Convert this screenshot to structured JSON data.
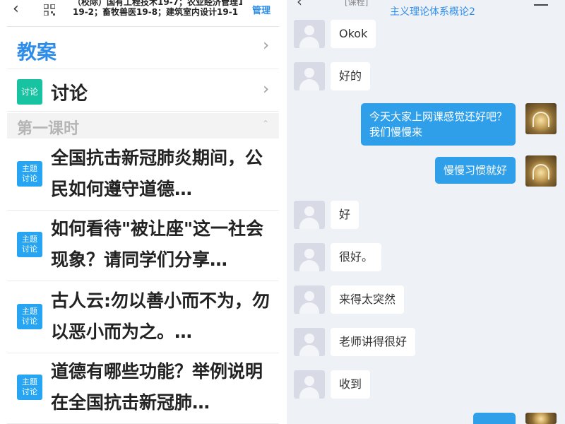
{
  "left_panel": {
    "header": {
      "back_icon": "back-arrow-icon",
      "qr_icon": "qr-code-icon",
      "class_line1": "（校际）国有工程技术19-7；农业经济管理19-",
      "class_line2": "19-2；畜牧兽医19-8；建筑室内设计19-1",
      "manage_label": "管理"
    },
    "jiaoan_label": "教案",
    "discussion": {
      "tag": "讨论",
      "label": "讨论"
    },
    "section_title": "第一课时",
    "topic_tag_line1": "主题",
    "topic_tag_line2": "讨论",
    "topics": [
      "全国抗击新冠肺炎期间，公民如何遵守道德…",
      "如何看待\"被让座\"这一社会现象？请同学们分享…",
      "古人云:勿以善小而不为，勿以恶小而为之。…",
      "道德有哪些功能？举例说明在全国抗击新冠肺…"
    ]
  },
  "right_panel": {
    "header": {
      "back_icon": "back-arrow-icon",
      "tag": "[课程]",
      "title": "主义理论体系概论2",
      "menu_icon": "menu-icon"
    },
    "messages": [
      {
        "side": "left",
        "text": "Okok"
      },
      {
        "side": "left",
        "text": "好的"
      },
      {
        "side": "right",
        "text": "今天大家上网课感觉还好吧？\n我们慢慢来"
      },
      {
        "side": "right",
        "text": "慢慢习惯就好"
      },
      {
        "side": "left",
        "text": "好"
      },
      {
        "side": "left",
        "text": "很好。"
      },
      {
        "side": "left",
        "text": "来得太突然"
      },
      {
        "side": "left",
        "text": "老师讲得很好"
      },
      {
        "side": "left",
        "text": "收到"
      }
    ]
  },
  "colors": {
    "accent_blue": "#2f8dea",
    "discussion_green": "#18c3a2",
    "topic_tag_blue": "#27a5f2",
    "chat_bg": "#eef1f6",
    "self_bubble": "#2f9fe9"
  }
}
